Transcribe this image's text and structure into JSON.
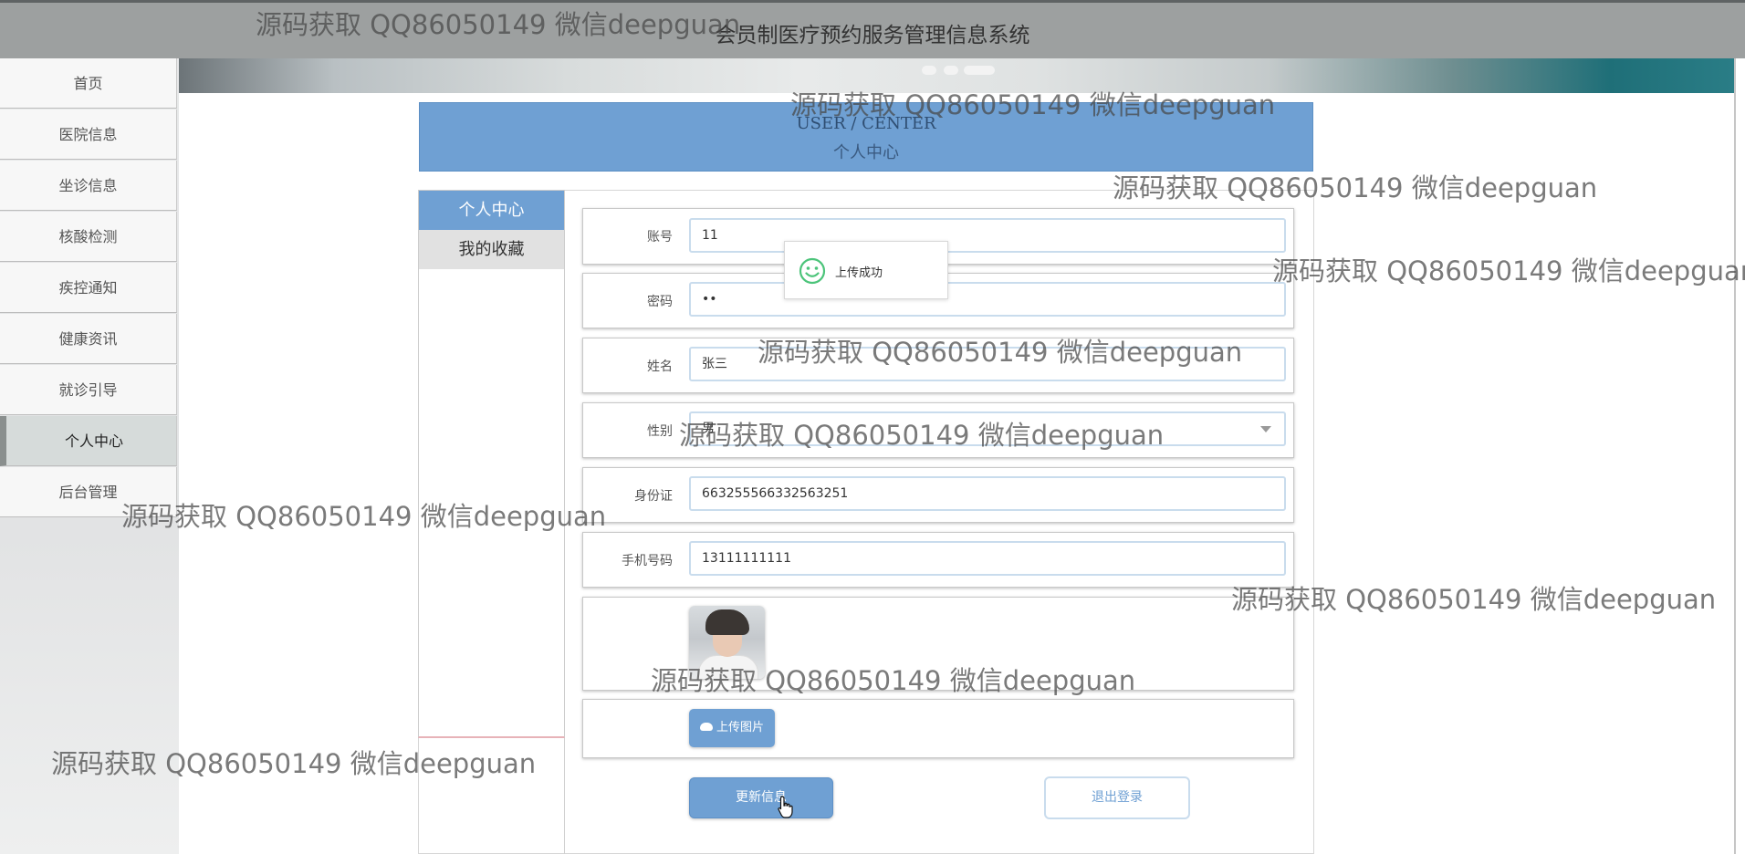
{
  "header": {
    "system_title": "会员制医疗预约服务管理信息系统"
  },
  "sidebar": {
    "items": [
      {
        "label": "首页"
      },
      {
        "label": "医院信息"
      },
      {
        "label": "坐诊信息"
      },
      {
        "label": "核酸检测"
      },
      {
        "label": "疾控通知"
      },
      {
        "label": "健康资讯"
      },
      {
        "label": "就诊引导"
      },
      {
        "label": "个人中心",
        "active": true
      },
      {
        "label": "后台管理"
      }
    ]
  },
  "user_center": {
    "title_en": "USER / CENTER",
    "title_cn": "个人中心",
    "tabs": [
      {
        "label": "个人中心",
        "active": true
      },
      {
        "label": "我的收藏"
      }
    ]
  },
  "form": {
    "account": {
      "label": "账号",
      "value": "11"
    },
    "password": {
      "label": "密码",
      "value": "••"
    },
    "name": {
      "label": "姓名",
      "value": "张三"
    },
    "gender": {
      "label": "性别",
      "value": "男"
    },
    "id_card": {
      "label": "身份证",
      "value": "663255566332563251"
    },
    "phone": {
      "label": "手机号码",
      "value": "13111111111"
    },
    "upload_label": "上传图片"
  },
  "buttons": {
    "update": "更新信息",
    "logout": "退出登录"
  },
  "toast": {
    "message": "上传成功"
  },
  "watermark": {
    "text": "源码获取 QQ86050149 微信deepguan"
  },
  "colors": {
    "accent": "#6fa0d3",
    "header_bg": "#9da0a0",
    "toast_icon": "#4cc47a"
  }
}
